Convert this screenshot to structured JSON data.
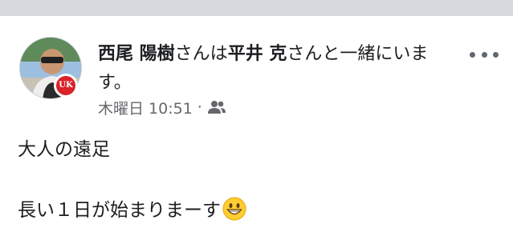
{
  "post": {
    "author": "西尾 陽樹",
    "text_with": "さんは",
    "tagged": "平井 克",
    "text_after": "さんと一緒にいます。",
    "timestamp": "木曜日 10:51",
    "separator": "·",
    "privacy_icon": "friends-icon",
    "more_icon": "more-options-icon",
    "badge_text": "UK",
    "body": {
      "line1": "大人の遠足",
      "line2": "",
      "line3": "長い１日が始まりまーす",
      "emoji": "grinning-face-emoji"
    }
  },
  "colors": {
    "top_band": "#d6d9dd",
    "meta_text": "#65676b",
    "badge": "#d9222a"
  }
}
